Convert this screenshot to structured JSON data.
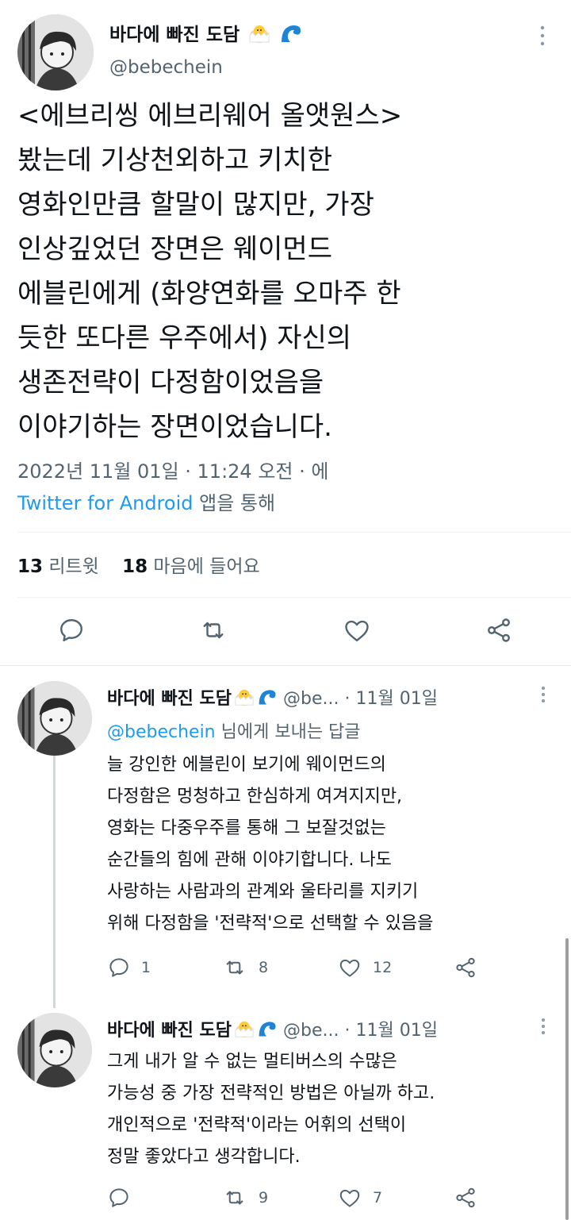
{
  "main_tweet": {
    "author_name": "바다에 빠진 도담",
    "handle": "@bebechein",
    "emoji": [
      "hatching-chick-emoji",
      "water-wave-emoji"
    ],
    "text_lines": [
      "<에브리씽 에브리웨어 올앳원스>",
      "봤는데 기상천외하고 키치한",
      "영화인만큼 할말이 많지만, 가장",
      "인상깊었던 장면은 웨이먼드",
      "에블린에게 (화양연화를 오마주 한",
      "듯한 또다른 우주에서) 자신의",
      "생존전략이 다정함이었음을",
      "이야기하는 장면이었습니다."
    ],
    "timestamp": "2022년 11월 01일 · 11:24 오전 · 에",
    "source_app": "Twitter for Android",
    "source_suffix": " 앱을 통해",
    "retweet_count": "13",
    "retweet_label": "리트윗",
    "like_count": "18",
    "like_label": "마음에 들어요"
  },
  "replies": [
    {
      "author_name": "바다에 빠진 도담",
      "handle": "@be...",
      "date": "· 11월 01일",
      "reply_to_handle": "@bebechein",
      "reply_to_suffix": " 님에게 보내는 답글",
      "text_lines": [
        "늘 강인한 에블린이 보기에 웨이먼드의",
        "다정함은 멍청하고 한심하게 여겨지지만,",
        "영화는 다중우주를 통해 그 보잘것없는",
        "순간들의 힘에 관해 이야기합니다. 나도",
        "사랑하는 사람과의 관계와 울타리를 지키기",
        "위해 다정함을 '전략적'으로 선택할 수 있음을"
      ],
      "reply_count": "1",
      "retweet_count": "8",
      "like_count": "12"
    },
    {
      "author_name": "바다에 빠진 도담",
      "handle": "@be...",
      "date": "· 11월 01일",
      "text_lines": [
        "그게 내가 알 수 없는 멀티버스의 수많은",
        "가능성 중 가장 전략적인 방법은 아닐까 하고.",
        "개인적으로 '전략적'이라는 어휘의 선택이",
        "정말 좋았다고 생각합니다."
      ],
      "reply_count": "",
      "retweet_count": "9",
      "like_count": "7"
    }
  ],
  "colors": {
    "text": "#0f1419",
    "secondary": "#536471",
    "link": "#1d9bf0",
    "divider": "#eff3f4"
  }
}
